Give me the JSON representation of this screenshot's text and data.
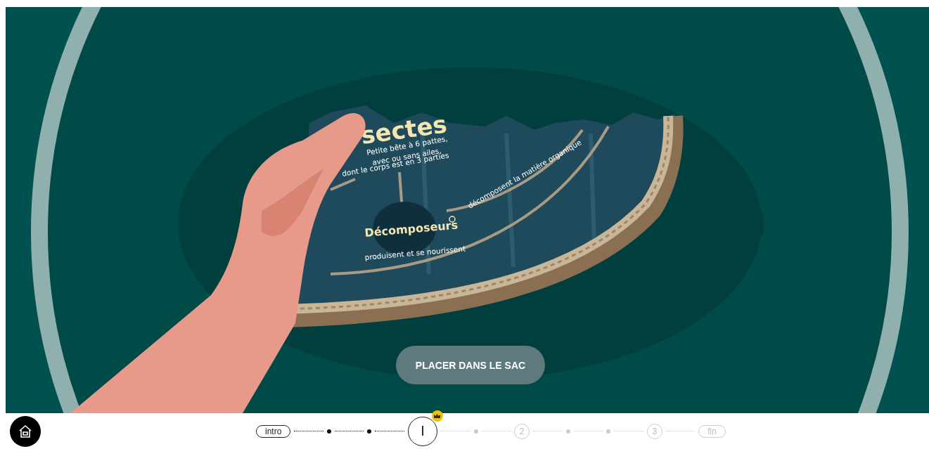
{
  "scene": {
    "title": "sectes",
    "description": [
      "Petite bête à 6 pattes,",
      "avec ou sans ailes,",
      "dont le corps est en 3 parties"
    ],
    "node": "Décomposeurs",
    "arrow_labels": [
      "décomposent la matière organique",
      "produisent et se nourissent"
    ]
  },
  "action_button": {
    "label": "PLACER DANS LE SAC"
  },
  "progress": {
    "steps": [
      {
        "kind": "pill",
        "label": "intro",
        "done": true,
        "selected": false
      },
      {
        "kind": "dot",
        "done": true
      },
      {
        "kind": "dot",
        "done": true
      },
      {
        "kind": "circle",
        "label": "I",
        "done": true,
        "selected": true,
        "crowned": true
      },
      {
        "kind": "dot",
        "done": false
      },
      {
        "kind": "circle",
        "label": "2",
        "done": false,
        "selected": false,
        "crowned": false
      },
      {
        "kind": "dot",
        "done": false
      },
      {
        "kind": "dot",
        "done": false
      },
      {
        "kind": "circle",
        "label": "3",
        "done": false,
        "selected": false,
        "crowned": false
      },
      {
        "kind": "pill",
        "label": "fin",
        "done": false,
        "selected": false
      }
    ]
  }
}
